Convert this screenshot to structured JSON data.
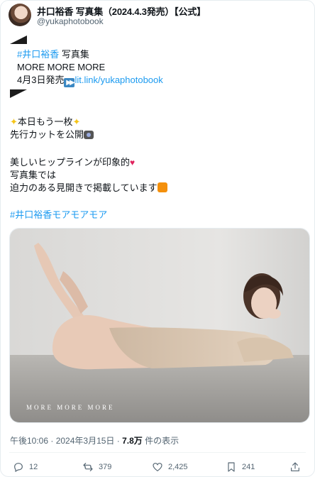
{
  "account": {
    "display_name": "井口裕香 写真集（2024.4.3発売）【公式】",
    "handle": "@yukaphotobook"
  },
  "post": {
    "line1_hashtag": "#井口裕香",
    "line1_text": " 写真集",
    "line2": "MORE MORE MORE",
    "line3_prefix": "4月3日発売",
    "line3_link": "lit.link/yukaphotobook",
    "line4": "本日もう一枚",
    "line5": "先行カットを公開",
    "line6": "美しいヒップラインが印象的",
    "line7": "写真集では",
    "line8": "迫力のある見開きで掲載しています",
    "hashtag2": "#井口裕香モアモアモア"
  },
  "image": {
    "overlay_caption": "MORE MORE MORE"
  },
  "meta": {
    "time": "午後10:06",
    "sep1": " · ",
    "date": "2024年3月15日",
    "sep2": " · ",
    "views_count": "7.8万",
    "views_label": " 件の表示"
  },
  "actions": {
    "replies": "12",
    "reposts": "379",
    "likes": "2,425",
    "bookmarks": "241"
  },
  "colors": {
    "link": "#1d9bf0",
    "muted": "#536471"
  }
}
